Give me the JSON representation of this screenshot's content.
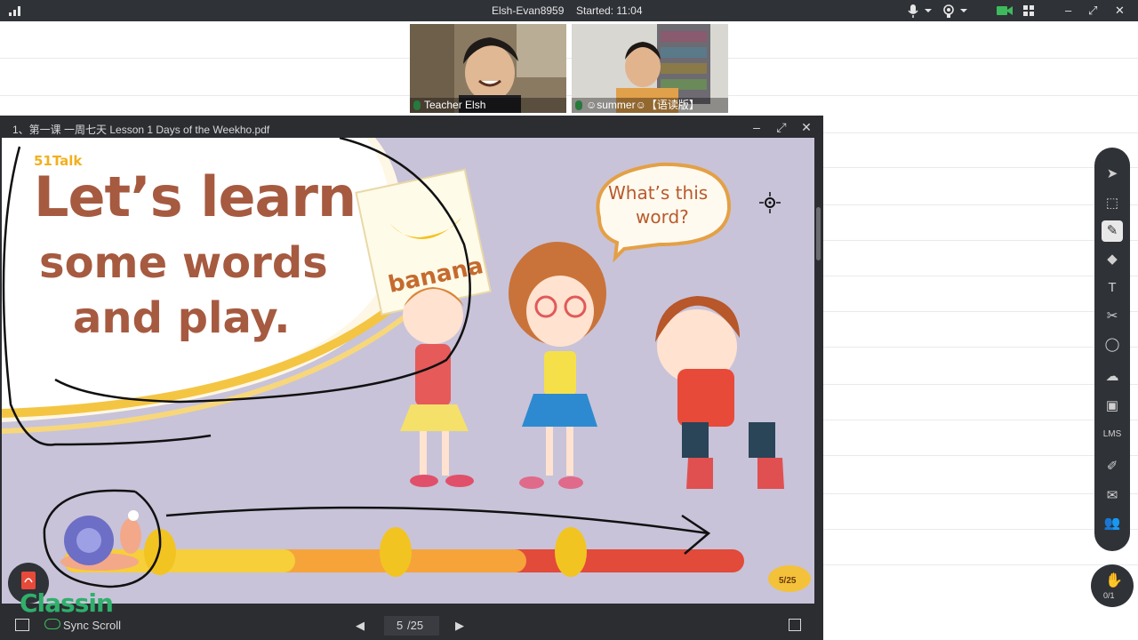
{
  "topbar": {
    "title": "Elsh-Evan8959",
    "started": "Started: 11:04"
  },
  "videos": [
    {
      "name": "Teacher Elsh"
    },
    {
      "name": "☺summer☺【语读版】"
    }
  ],
  "document": {
    "filename": "1、第一课 一周七天 Lesson 1 Days of the Weekho.pdf",
    "page_current": "5",
    "page_total": "/25",
    "sync_scroll_label": "Sync Scroll"
  },
  "slide": {
    "brand": "51Talk",
    "headline_1": "Let’s learn",
    "headline_2": "some words",
    "headline_3": "and play.",
    "card_word": "banana",
    "bubble_1": "What’s this",
    "bubble_2": "word?",
    "page_badge": "5/25"
  },
  "toolbar": {
    "lms_label": "LMS",
    "hand_count": "0/1"
  },
  "brand": {
    "logo_text": "Classin",
    "accent": "#2fb06b"
  }
}
